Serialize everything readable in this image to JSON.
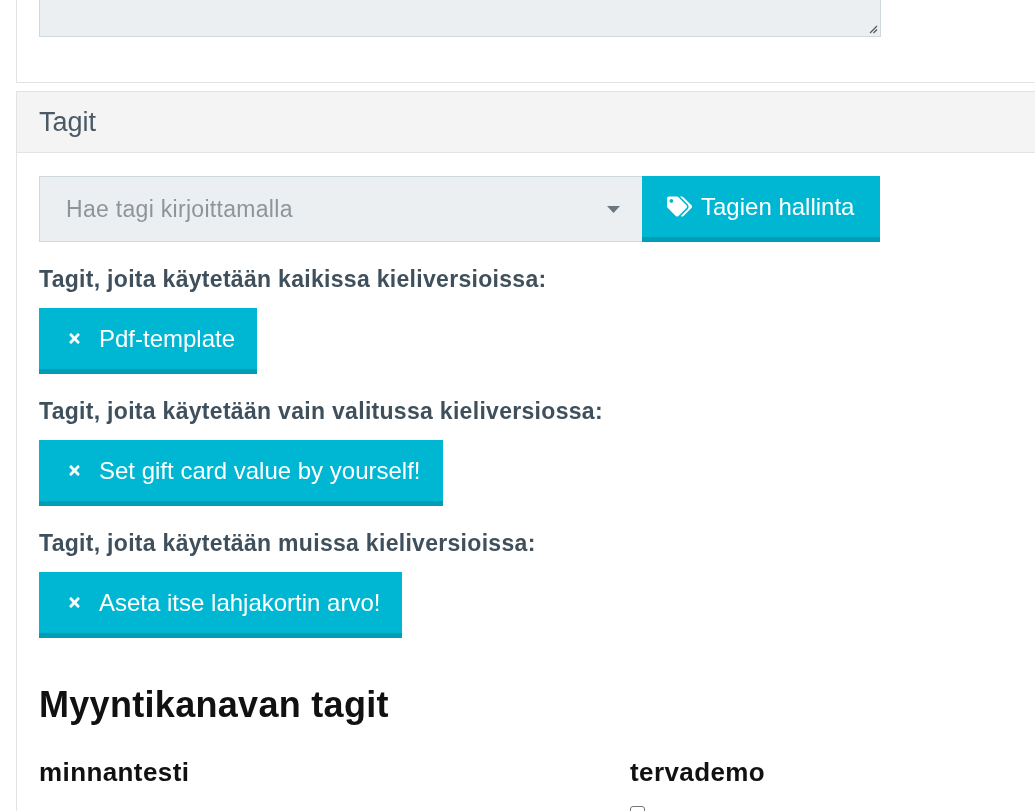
{
  "tags_panel": {
    "title": "Tagit",
    "search": {
      "placeholder": "Hae tagi kirjoittamalla"
    },
    "manage_button": {
      "label": "Tagien hallinta"
    },
    "groups": [
      {
        "label": "Tagit, joita käytetään kaikissa kieliversioissa:",
        "tags": [
          "Pdf-template"
        ]
      },
      {
        "label": "Tagit, joita käytetään vain valitussa kieliversiossa:",
        "tags": [
          "Set gift card value by yourself!"
        ]
      },
      {
        "label": "Tagit, joita käytetään muissa kieliversioissa:",
        "tags": [
          "Aseta itse lahjakortin arvo!"
        ]
      }
    ],
    "sales_channels": {
      "title": "Myyntikanavan tagit",
      "channels": [
        {
          "name": "minnantesti"
        },
        {
          "name": "tervademo",
          "checkbox": {
            "checked": false
          }
        }
      ]
    }
  }
}
